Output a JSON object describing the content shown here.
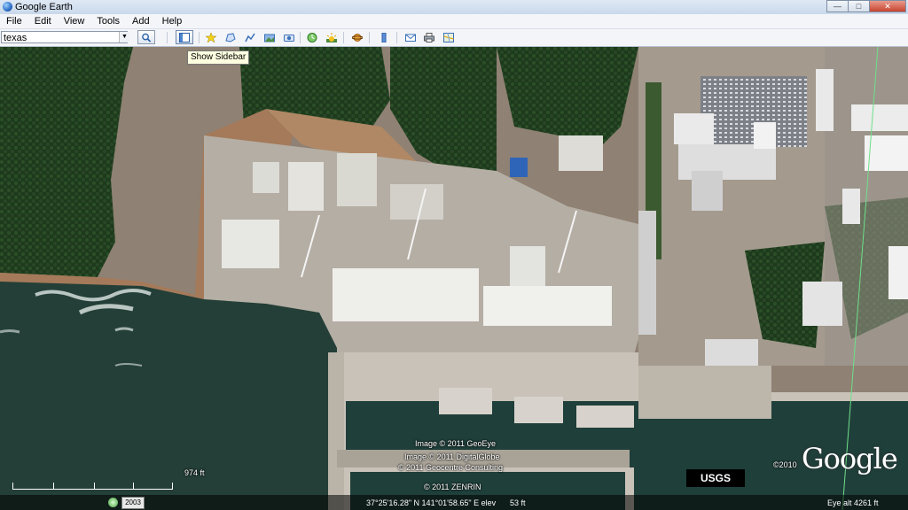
{
  "window": {
    "title": "Google Earth",
    "controls": [
      "—",
      "□",
      "✕"
    ]
  },
  "menu": [
    "File",
    "Edit",
    "View",
    "Tools",
    "Add",
    "Help"
  ],
  "search": {
    "value": "texas"
  },
  "tooltip": "Show Sidebar",
  "map": {
    "attributions": {
      "geoeye": "Image © 2011 GeoEye",
      "digitalglobe": "Image © 2011 DigitalGlobe",
      "geocentre": "© 2011 Geocentre Consulting",
      "zenrin": "© 2011 ZENRIN",
      "google_year": "©2010"
    },
    "logo_text": "Google",
    "usgs_label": "USGS",
    "scale_label": "974 ft",
    "year_slider": "2003",
    "coords": "37°25'16.28\" N 141°01'58.65\" E  elev",
    "elev": "53 ft",
    "eye_alt": "Eye alt  4261 ft"
  }
}
